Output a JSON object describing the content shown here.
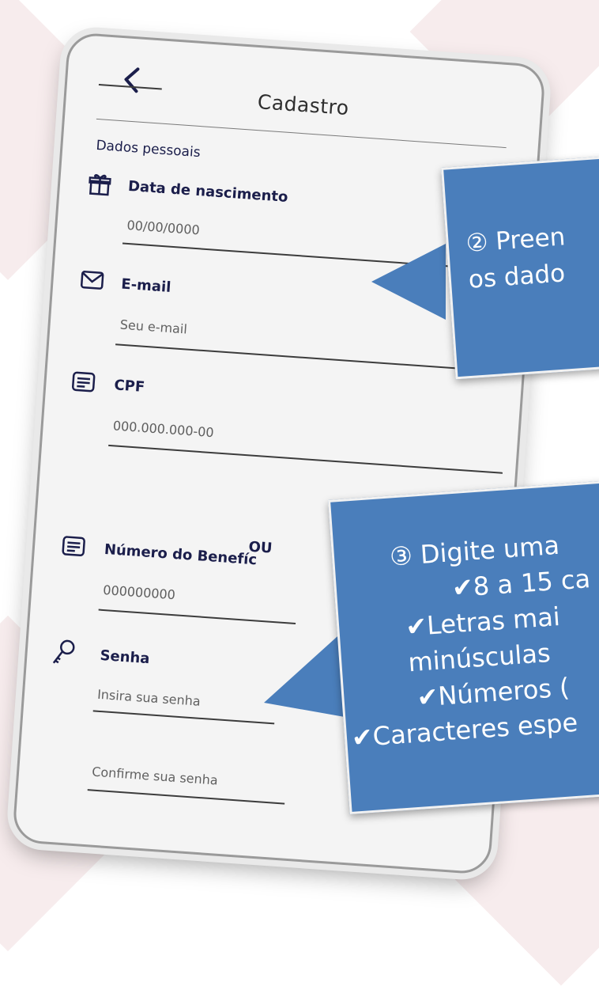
{
  "header": {
    "title": "Cadastro",
    "back_icon": "chevron-left-icon"
  },
  "section": {
    "title": "Dados pessoais"
  },
  "fields": {
    "birth": {
      "label": "Data de nascimento",
      "placeholder": "00/00/0000",
      "icon": "gift-icon"
    },
    "email": {
      "label": "E-mail",
      "placeholder": "Seu e-mail",
      "icon": "envelope-icon"
    },
    "cpf": {
      "label": "CPF",
      "placeholder": "000.000.000-00",
      "icon": "document-icon"
    },
    "separator": "OU",
    "benefit": {
      "label": "Número do Benefíc",
      "placeholder": "000000000",
      "icon": "document-icon"
    },
    "password": {
      "label": "Senha",
      "placeholder": "Insira sua senha",
      "icon": "key-icon"
    },
    "confirm": {
      "placeholder": "Confirme sua senha"
    }
  },
  "callouts": {
    "step2": {
      "lines": [
        "② Preen",
        "os dado"
      ]
    },
    "step3": {
      "lines": [
        "③ Digite uma",
        "✔8 a 15 ca",
        "✔Letras mai",
        "minúsculas",
        "✔Números (",
        "✔Caracteres espe"
      ]
    }
  },
  "colors": {
    "callout": "#4a7ebb",
    "label": "#1b1e4b",
    "screen": "#f4f4f4"
  }
}
